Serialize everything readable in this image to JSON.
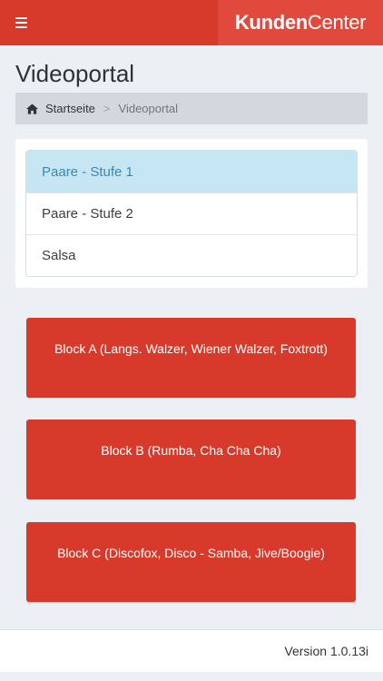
{
  "header": {
    "brand_bold": "Kunden",
    "brand_light": "Center",
    "menu_icon": "hamburger-icon",
    "accent_color": "#d7392a"
  },
  "page": {
    "title": "Videoportal"
  },
  "breadcrumb": {
    "home_icon": "home-icon",
    "home_label": "Startseite",
    "separator": ">",
    "current_label": "Videoportal"
  },
  "course_list": {
    "items": [
      {
        "label": "Paare - Stufe 1",
        "active": true
      },
      {
        "label": "Paare - Stufe 2",
        "active": false
      },
      {
        "label": "Salsa",
        "active": false
      }
    ]
  },
  "blocks": [
    {
      "label": "Block A (Langs. Walzer, Wiener Walzer, Foxtrott)"
    },
    {
      "label": "Block B (Rumba, Cha Cha Cha)"
    },
    {
      "label": "Block C (Discofox, Disco - Samba, Jive/Boogie)"
    }
  ],
  "footer": {
    "version": "Version 1.0.13i"
  }
}
